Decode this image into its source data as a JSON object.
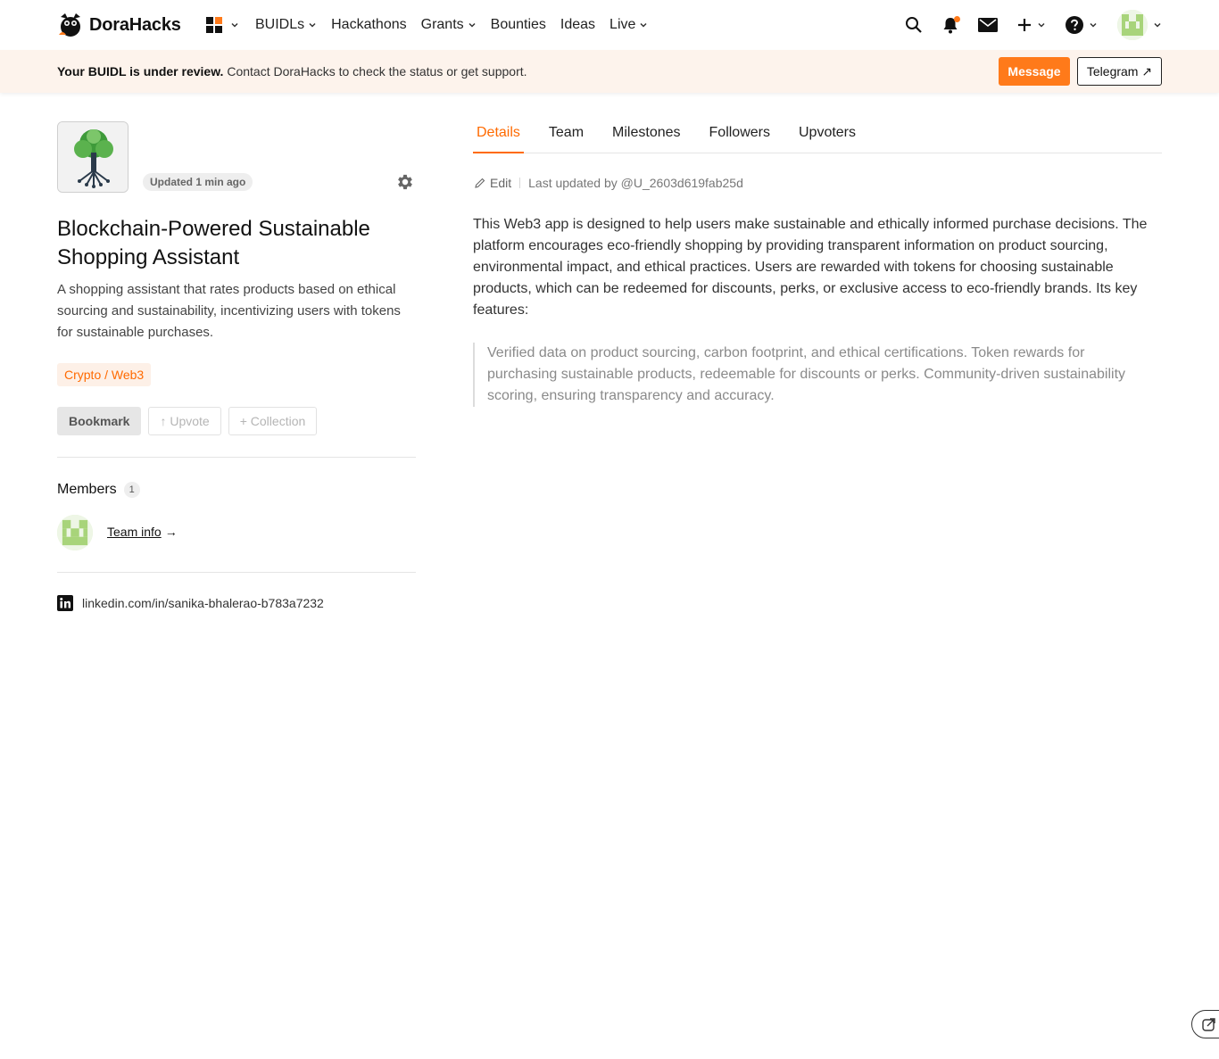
{
  "brand": {
    "name": "DoraHacks"
  },
  "nav": {
    "items": [
      {
        "label": "BUIDLs",
        "has_menu": true
      },
      {
        "label": "Hackathons",
        "has_menu": false
      },
      {
        "label": "Grants",
        "has_menu": true
      },
      {
        "label": "Bounties",
        "has_menu": false
      },
      {
        "label": "Ideas",
        "has_menu": false
      },
      {
        "label": "Live",
        "has_menu": true
      }
    ],
    "right_icons": [
      "search-icon",
      "bell-icon",
      "mail-icon",
      "plus-icon",
      "help-icon",
      "avatar"
    ]
  },
  "banner": {
    "strong": "Your BUIDL is under review.",
    "text": " Contact DoraHacks to check the status or get support.",
    "message_label": "Message",
    "telegram_label": "Telegram ↗"
  },
  "project": {
    "updated": "Updated 1 min ago",
    "title": "Blockchain-Powered Sustainable Shopping Assistant",
    "description": "A shopping assistant that rates products based on ethical sourcing and sustainability, incentivizing users with tokens for sustainable purchases.",
    "tag": "Crypto / Web3",
    "actions": {
      "bookmark": "Bookmark",
      "upvote": "↑ Upvote",
      "collection": "+ Collection"
    }
  },
  "members": {
    "heading": "Members",
    "count": "1",
    "team_link": "Team info",
    "arrow": "→"
  },
  "social": {
    "linkedin": "linkedin.com/in/sanika-bhalerao-b783a7232"
  },
  "tabs": {
    "active": "Details",
    "items": [
      "Details",
      "Team",
      "Milestones",
      "Followers",
      "Upvoters"
    ]
  },
  "details": {
    "edit_label": "Edit",
    "last_updated": "Last updated by @U_2603d619fab25d",
    "body": "This Web3 app is designed to help users make sustainable and ethically informed purchase decisions. The platform encourages eco-friendly shopping by providing transparent information on product sourcing, environmental impact, and ethical practices. Users are rewarded with tokens for choosing sustainable products, which can be redeemed for discounts, perks, or exclusive access to eco-friendly brands. Its key features:",
    "quote": "Verified data on product sourcing, carbon footprint, and ethical certifications. Token rewards for purchasing sustainable products, redeemable for discounts or perks. Community-driven sustainability scoring, ensuring transparency and accuracy."
  },
  "colors": {
    "accent": "#ff7a1a",
    "banner_bg": "#fdf3ec",
    "tag_bg": "#fdf0e7"
  }
}
